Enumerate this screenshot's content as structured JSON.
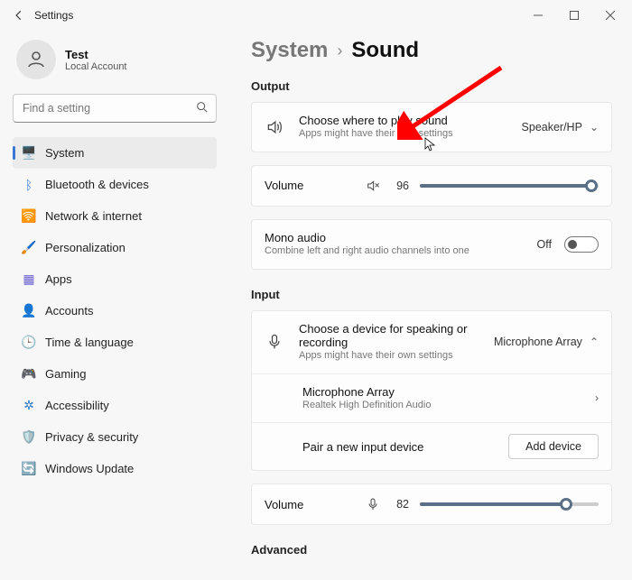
{
  "window": {
    "title": "Settings"
  },
  "user": {
    "name": "Test",
    "type": "Local Account"
  },
  "search": {
    "placeholder": "Find a setting"
  },
  "nav": {
    "system": "System",
    "bluetooth": "Bluetooth & devices",
    "network": "Network & internet",
    "personalization": "Personalization",
    "apps": "Apps",
    "accounts": "Accounts",
    "time": "Time & language",
    "gaming": "Gaming",
    "accessibility": "Accessibility",
    "privacy": "Privacy & security",
    "update": "Windows Update"
  },
  "breadcrumb": {
    "parent": "System",
    "title": "Sound"
  },
  "sections": {
    "output": "Output",
    "input": "Input",
    "advanced": "Advanced"
  },
  "output": {
    "choose_title": "Choose where to play sound",
    "choose_sub": "Apps might have their own settings",
    "choose_value": "Speaker/HP",
    "volume_label": "Volume",
    "volume_value": "96",
    "mono_title": "Mono audio",
    "mono_sub": "Combine left and right audio channels into one",
    "mono_state": "Off"
  },
  "input": {
    "choose_title": "Choose a device for speaking or recording",
    "choose_sub": "Apps might have their own settings",
    "choose_value": "Microphone Array",
    "device_title": "Microphone Array",
    "device_sub": "Realtek High Definition Audio",
    "pair_title": "Pair a new input device",
    "add_btn": "Add device",
    "volume_label": "Volume",
    "volume_value": "82"
  }
}
